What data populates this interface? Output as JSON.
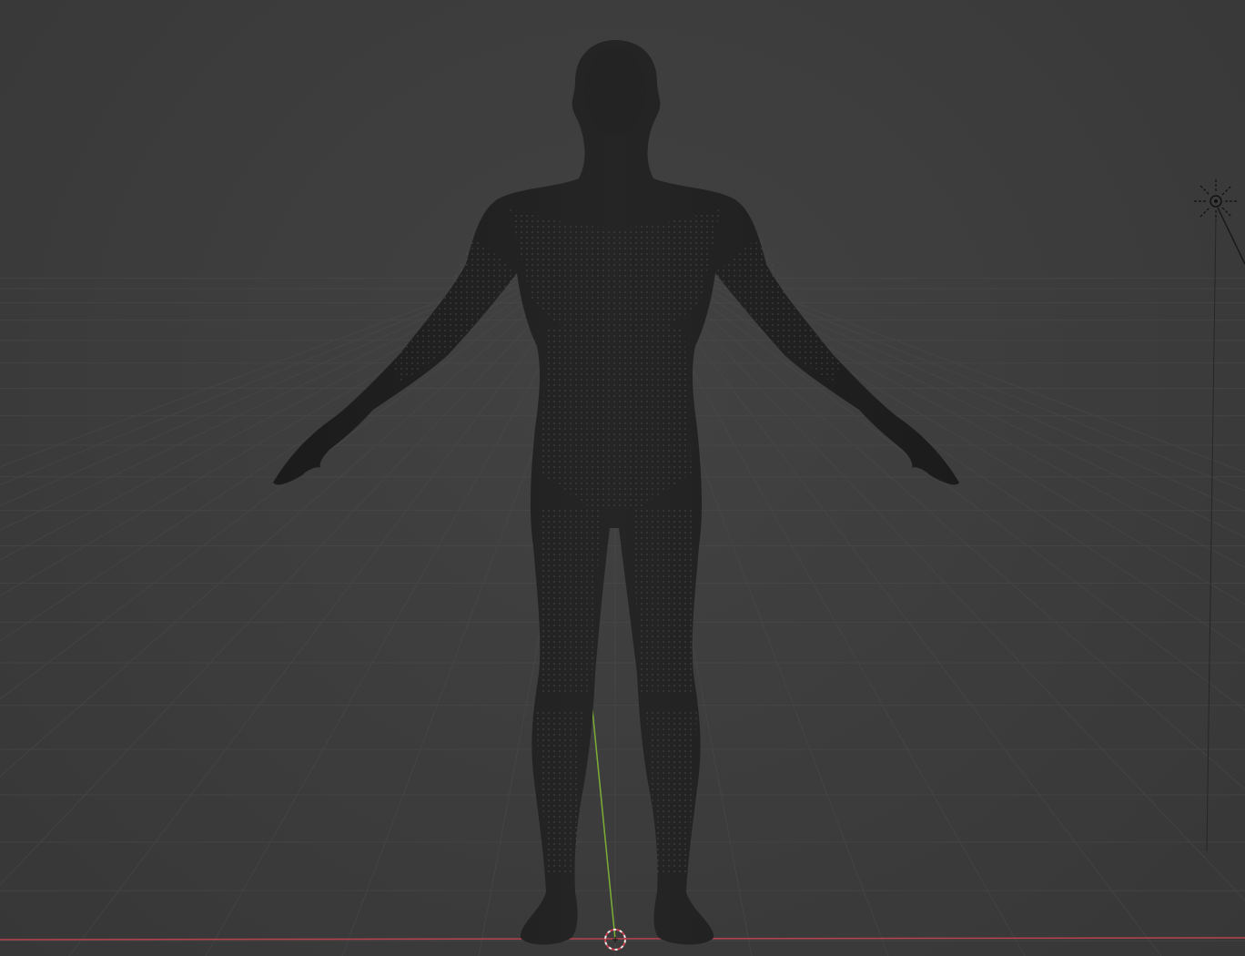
{
  "viewport": {
    "mode": "3d-viewport",
    "background_color": "#3d3d3d",
    "grid_color": "#4a4a4a",
    "x_axis_color": "#c4434f",
    "y_axis_color": "#7aa937",
    "mesh_color": "#1f1f1f",
    "mesh_dot_color": "#5a5a5a"
  },
  "scene": {
    "objects": [
      {
        "name": "human-mesh",
        "icon": "mesh-icon"
      },
      {
        "name": "3d-cursor",
        "icon": "cursor-icon"
      },
      {
        "name": "light",
        "icon": "sun-light-icon"
      }
    ]
  }
}
